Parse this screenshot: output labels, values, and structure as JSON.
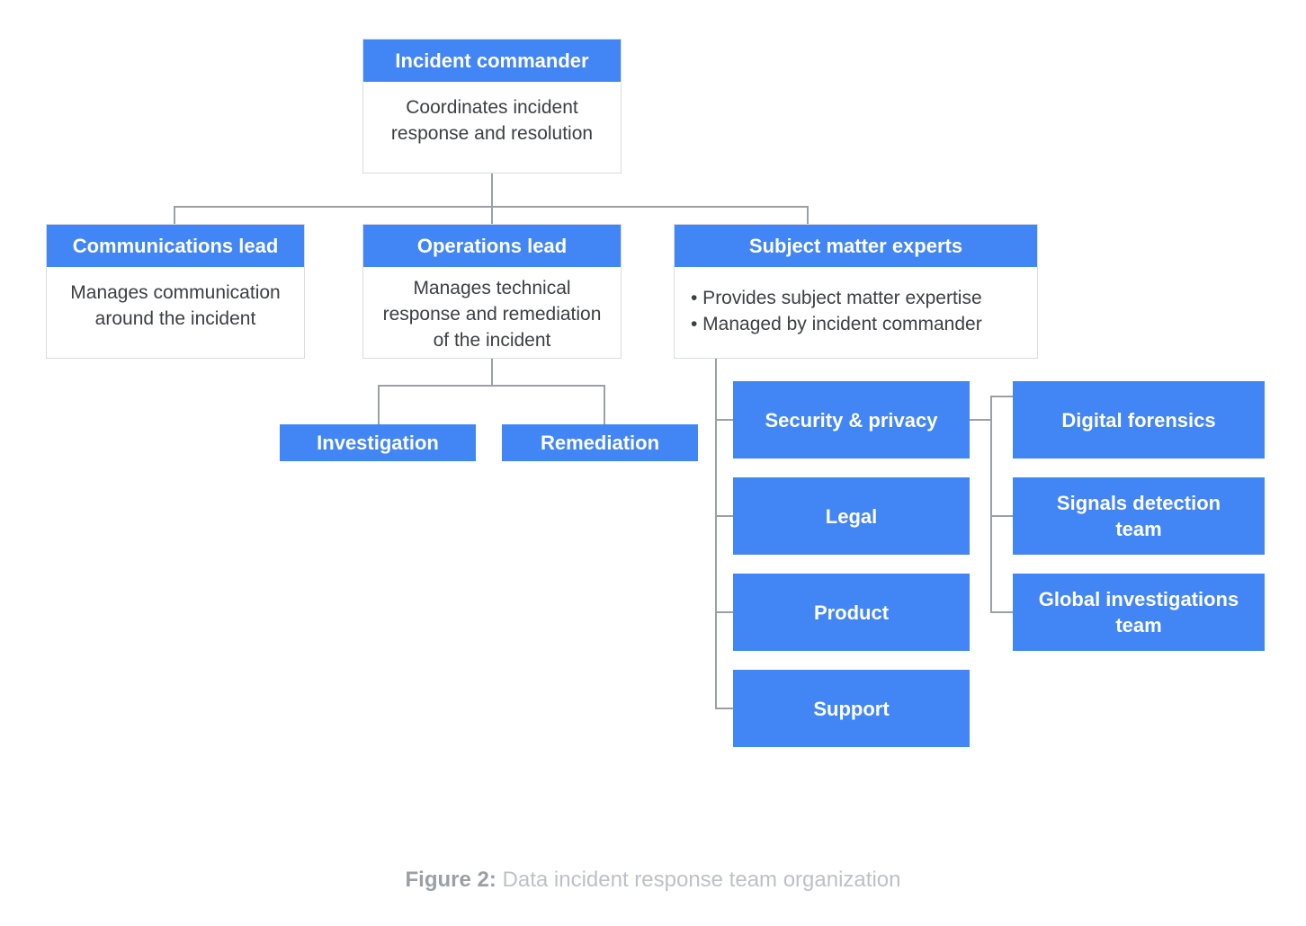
{
  "figure": {
    "label": "Figure 2:",
    "caption": "Data incident response team organization"
  },
  "colors": {
    "accent_blue": "#4285F4",
    "connector_gray": "#9AA0A6",
    "border_gray": "#DADCE0",
    "body_text": "#3C4043",
    "caption_text": "#BDC1C6",
    "background": "#FFFFFF"
  },
  "nodes": {
    "incident_commander": {
      "title": "Incident commander",
      "description_line1": "Coordinates incident",
      "description_line2": "response and resolution"
    },
    "communications_lead": {
      "title": "Communications lead",
      "description_line1": "Manages communication",
      "description_line2": "around the incident"
    },
    "operations_lead": {
      "title": "Operations lead",
      "description_line1": "Manages technical",
      "description_line2": "response and remediation",
      "description_line3": "of the incident"
    },
    "subject_matter_experts": {
      "title": "Subject matter experts",
      "bullet1": "• Provides subject matter expertise",
      "bullet2": "• Managed by incident commander"
    },
    "investigation": {
      "title": "Investigation"
    },
    "remediation": {
      "title": "Remediation"
    },
    "security_privacy": {
      "title": "Security & privacy"
    },
    "legal": {
      "title": "Legal"
    },
    "product": {
      "title": "Product"
    },
    "support": {
      "title": "Support"
    },
    "digital_forensics": {
      "title": "Digital forensics"
    },
    "signals_detection_team": {
      "title": "Signals detection\nteam"
    },
    "global_investigations_team": {
      "title": "Global investigations\nteam"
    }
  },
  "hierarchy": {
    "root": "Incident commander",
    "children_of_root": [
      "Communications lead",
      "Operations lead",
      "Subject matter experts"
    ],
    "children_of_operations_lead": [
      "Investigation",
      "Remediation"
    ],
    "children_of_subject_matter_experts": [
      "Security & privacy",
      "Legal",
      "Product",
      "Support"
    ],
    "children_of_security_privacy": [
      "Digital forensics",
      "Signals detection team",
      "Global investigations team"
    ]
  }
}
